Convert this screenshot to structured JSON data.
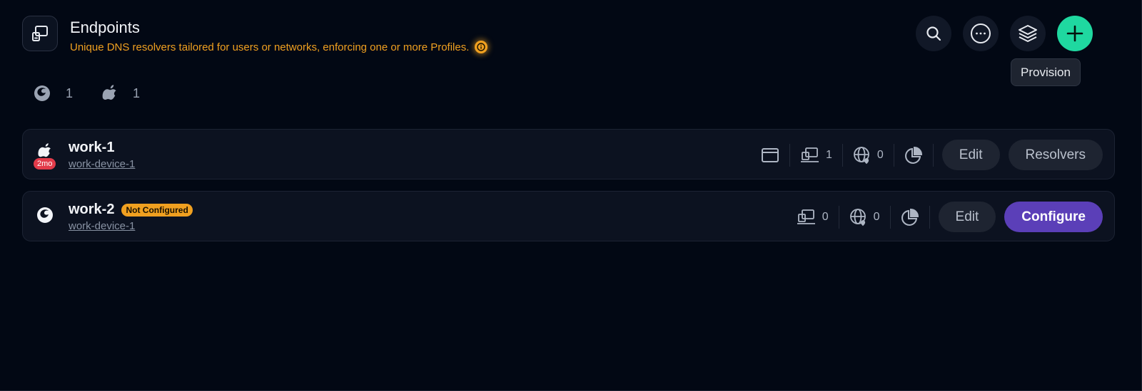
{
  "header": {
    "title": "Endpoints",
    "subtitle": "Unique DNS resolvers tailored for users or networks, enforcing one or more Profiles."
  },
  "tooltip": {
    "text": "Provision"
  },
  "os_counts": [
    {
      "icon": "firefox-os-icon",
      "count": "1"
    },
    {
      "icon": "apple-icon",
      "count": "1"
    }
  ],
  "endpoints": [
    {
      "name": "work-1",
      "device": "work-device-1",
      "age": "2mo",
      "os": "apple",
      "devices_count": "1",
      "networks_count": "0",
      "edit_label": "Edit",
      "action_label": "Resolvers"
    },
    {
      "name": "work-2",
      "device": "work-device-1",
      "status": "Not Configured",
      "os": "firefox",
      "devices_count": "0",
      "networks_count": "0",
      "edit_label": "Edit",
      "action_label": "Configure"
    }
  ],
  "colors": {
    "accent_add": "#1fd8a0",
    "warning": "#f0a020",
    "primary": "#5b3fb8",
    "age_badge": "#e23b4a"
  }
}
